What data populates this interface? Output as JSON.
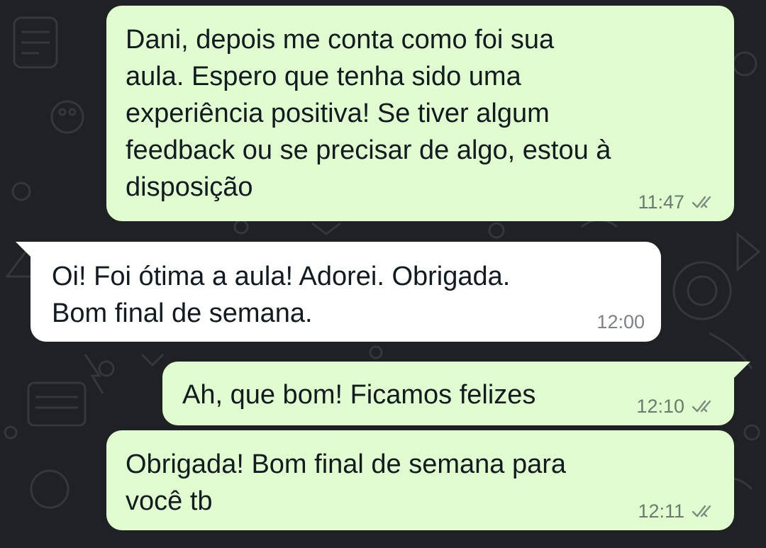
{
  "conversation": {
    "messages": [
      {
        "direction": "outgoing",
        "text": "Dani, depois me conta como foi sua\naula. Espero que tenha sido uma\nexperiência positiva! Se tiver algum\nfeedback ou se precisar de algo, estou à\ndisposição",
        "time": "11:47",
        "status_icon": "double-check-icon"
      },
      {
        "direction": "incoming",
        "text": "Oi! Foi ótima a aula! Adorei. Obrigada.\nBom final de semana.",
        "time": "12:00"
      },
      {
        "direction": "outgoing",
        "text": "Ah, que bom! Ficamos felizes",
        "time": "12:10",
        "status_icon": "double-check-icon"
      },
      {
        "direction": "outgoing",
        "text": "Obrigada! Bom final de semana para\nvocê tb",
        "time": "12:11",
        "status_icon": "double-check-icon"
      }
    ]
  },
  "colors": {
    "background": "#202124",
    "outgoing_bubble": "#e1fdcf",
    "incoming_bubble": "#ffffff",
    "timestamp": "#6b7a70"
  }
}
